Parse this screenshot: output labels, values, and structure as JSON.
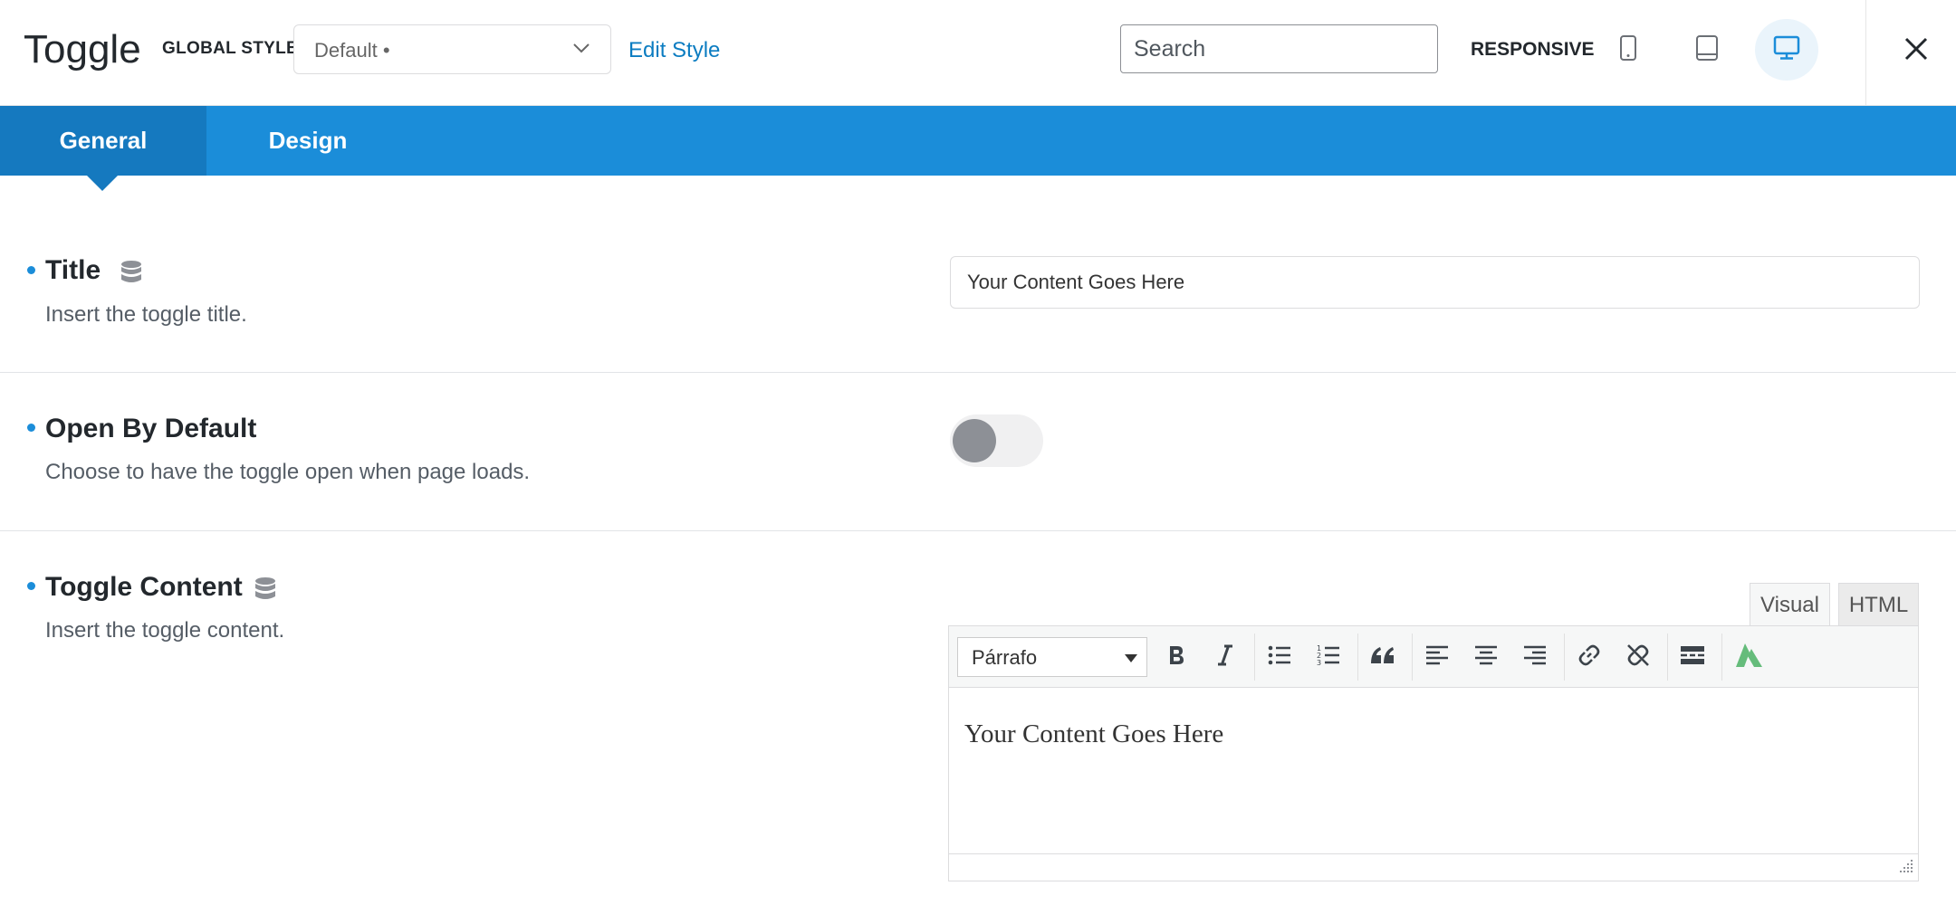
{
  "header": {
    "title": "Toggle",
    "global_style_label": "GLOBAL STYLE",
    "global_style_value": "Default •",
    "edit_style_label": "Edit Style",
    "search_placeholder": "Search",
    "responsive_label": "RESPONSIVE",
    "devices": [
      "phone-icon",
      "tablet-icon",
      "desktop-icon"
    ],
    "active_device": "desktop"
  },
  "tabs": [
    {
      "label": "General",
      "active": true
    },
    {
      "label": "Design",
      "active": false
    }
  ],
  "fields": {
    "title": {
      "label": "Title",
      "description": "Insert the toggle title.",
      "value": "Your Content Goes Here"
    },
    "open_by_default": {
      "label": "Open By Default",
      "description": "Choose to have the toggle open when page loads.",
      "on": false
    },
    "toggle_content": {
      "label": "Toggle Content",
      "description": "Insert the toggle content.",
      "editor_tabs": [
        "Visual",
        "HTML"
      ],
      "format_value": "Párrafo",
      "content": "Your Content Goes Here"
    }
  },
  "colors": {
    "accent": "#1b8dd9",
    "accent_dark": "#1579bf",
    "link": "#0b7cc1"
  }
}
